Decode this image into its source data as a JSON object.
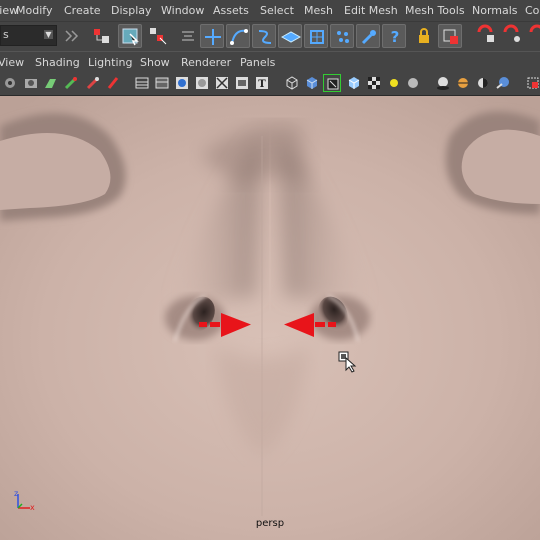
{
  "menubar": {
    "items": [
      "View",
      "Modify",
      "Create",
      "Display",
      "Window",
      "Assets",
      "Select",
      "Mesh",
      "Edit Mesh",
      "Mesh Tools",
      "Normals",
      "Col"
    ]
  },
  "toolbar": {
    "mode_dropdown": {
      "value": "s"
    },
    "icons": [
      "input-arrow-icon",
      "output-arrow-icon",
      "select-by-hierarchy-icon",
      "select-object-icon",
      "select-component-icon",
      "snap-to-grid-icon",
      "snap-to-curve-icon",
      "snap-to-point-icon",
      "snap-to-view-plane-icon",
      "make-live-icon",
      "history-icon",
      "render-icon",
      "help-icon",
      "lock-icon",
      "selection-lock-icon",
      "ipr-render-icon",
      "render-settings-icon"
    ]
  },
  "panel_menu": {
    "items": [
      "View",
      "Shading",
      "Lighting",
      "Show",
      "Renderer",
      "Panels"
    ]
  },
  "panel_toolbar": {
    "icons": [
      "camera-attributes-icon",
      "bookmark-icon",
      "image-plane-icon",
      "film-gate-icon",
      "resolution-gate-icon",
      "grid-icon",
      "wireframe-icon",
      "smooth-shade-icon",
      "wireframe-on-shaded-icon",
      "xray-icon",
      "texture-icon",
      "cube-wire-icon",
      "cube-shaded-icon",
      "isolate-select-icon",
      "cube-light-icon",
      "checker-icon",
      "light-yellow-icon",
      "light-grey-icon",
      "shadow-sphere-icon",
      "ambient-occlusion-icon",
      "motion-blur-icon",
      "multisample-icon",
      "gamma-icon"
    ]
  },
  "viewport": {
    "camera_label": "persp",
    "axis_labels": {
      "z": "z",
      "x": "x"
    },
    "colors": {
      "skin": "#cfb5ac",
      "annotation_arrow": "#e8141a"
    }
  }
}
